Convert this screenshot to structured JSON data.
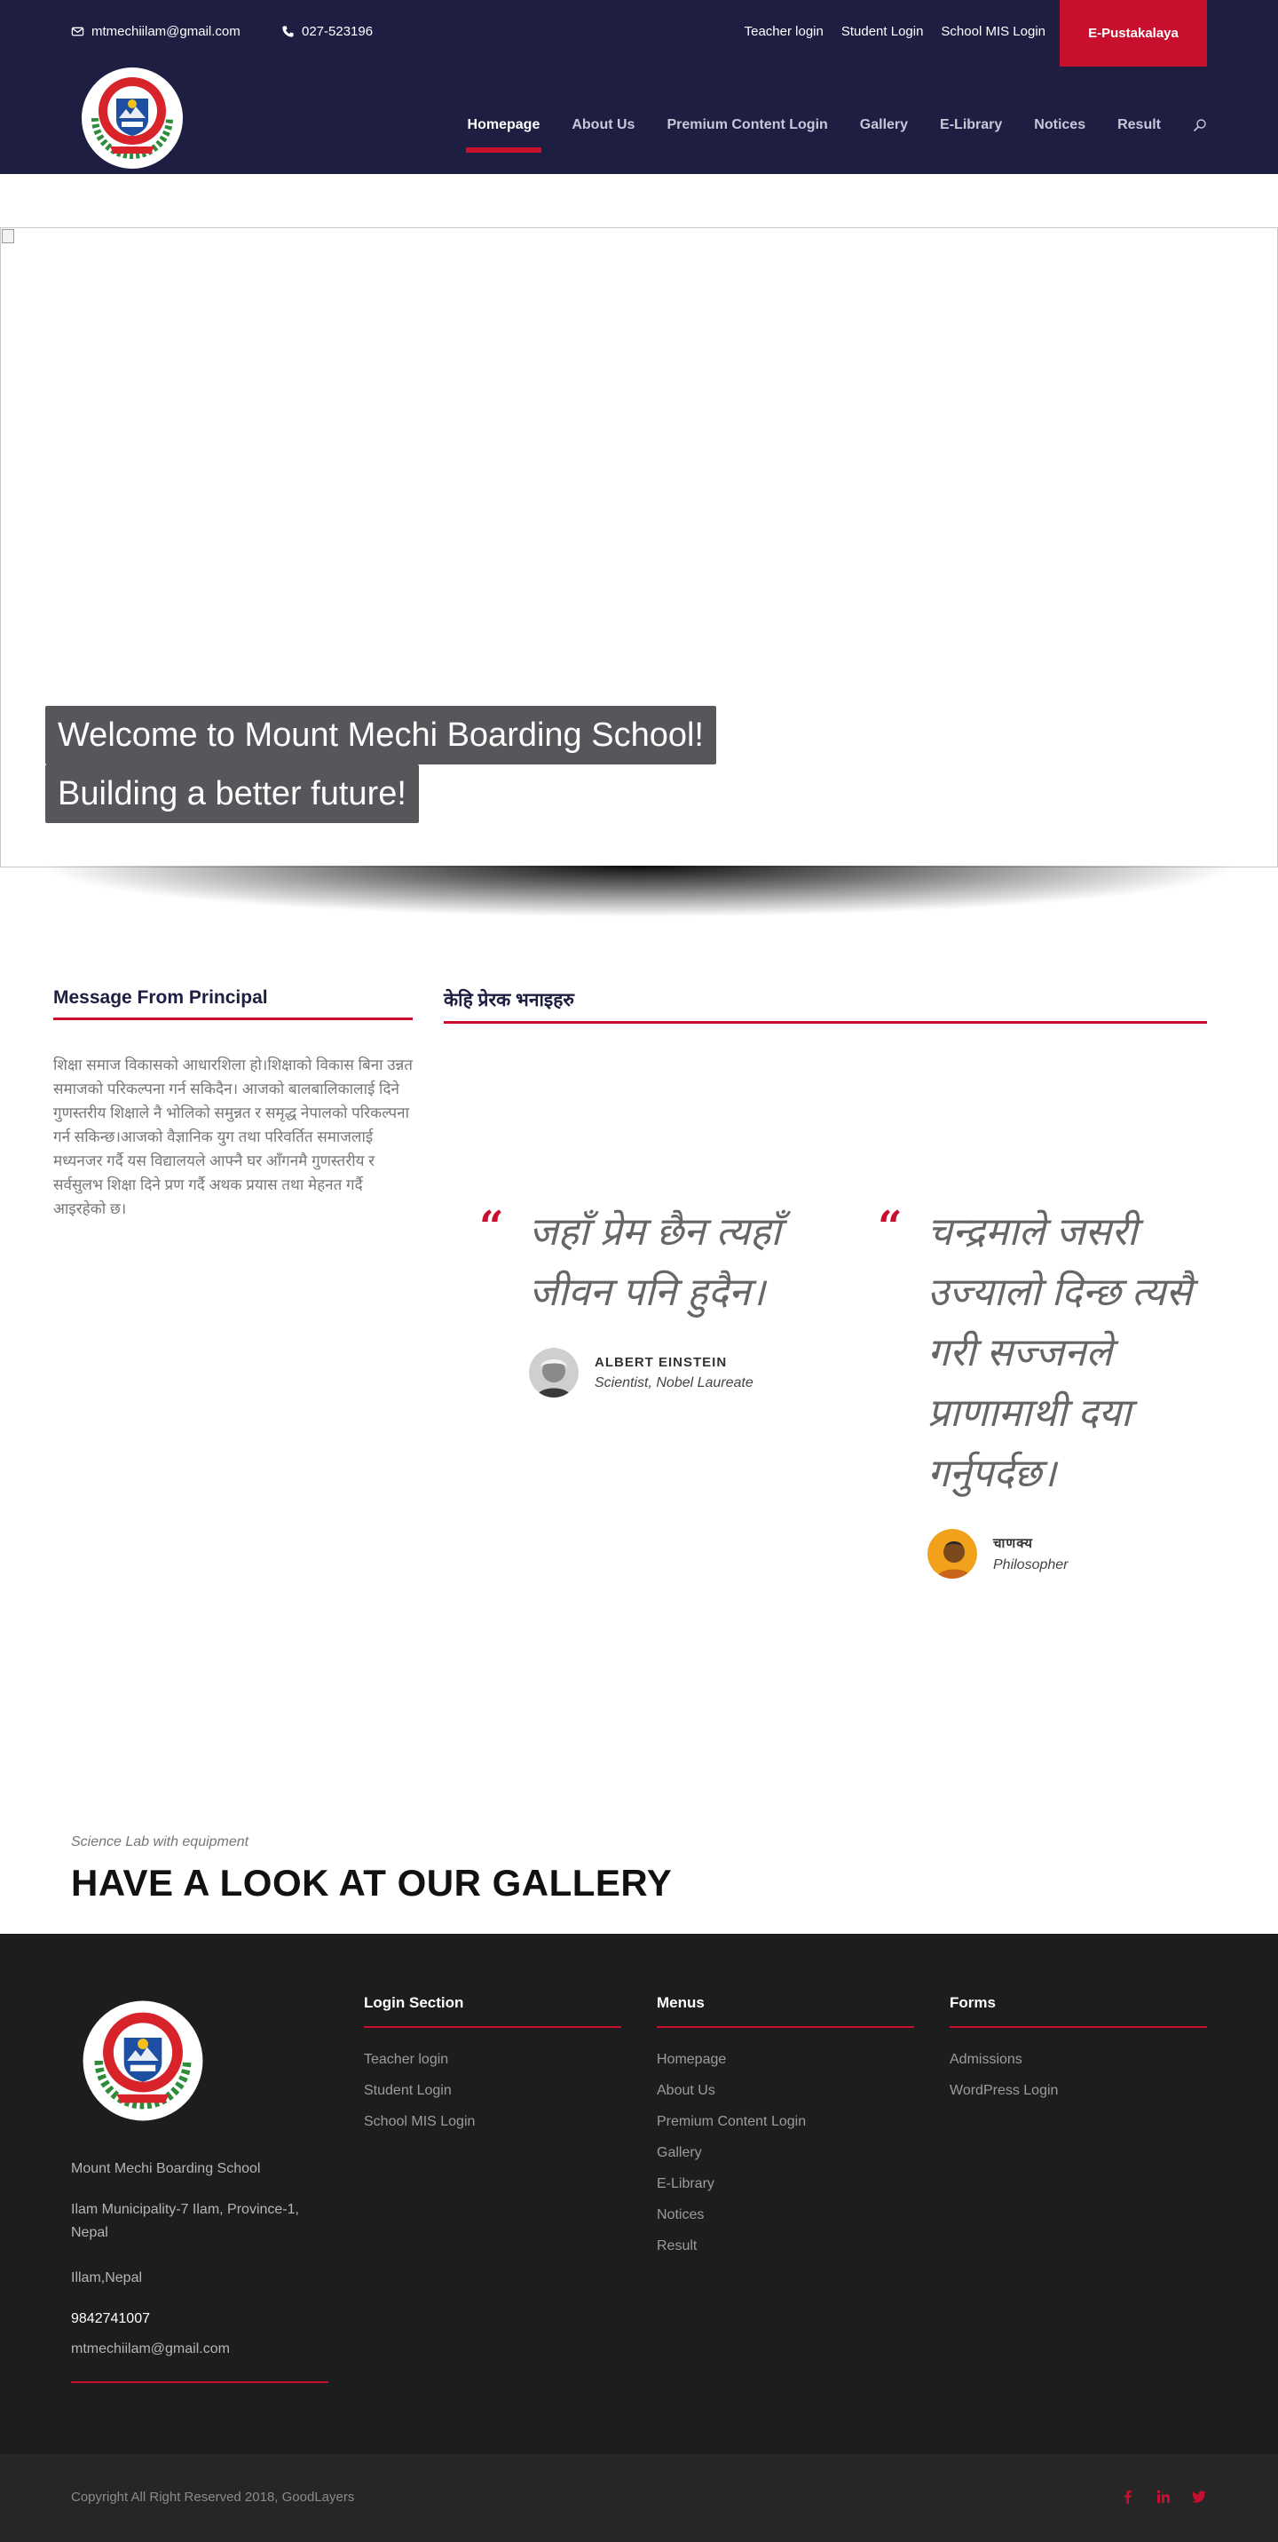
{
  "topbar": {
    "email": "mtmechiilam@gmail.com",
    "phone": "027-523196",
    "links": [
      "Teacher login",
      "Student Login",
      "School MIS Login"
    ],
    "cta": "E-Pustakalaya"
  },
  "nav": {
    "items": [
      "Homepage",
      "About Us",
      "Premium Content Login",
      "Gallery",
      "E-Library",
      "Notices",
      "Result"
    ],
    "active": "Homepage"
  },
  "hero": {
    "caption_1": "Welcome to Mount Mechi Boarding School!",
    "caption_2": "Building a better future!"
  },
  "principal": {
    "title": "Message From Principal",
    "text": "शिक्षा समाज विकासको आधारशिला हो।शिक्षाको विकास बिना उन्नत समाजको परिकल्पना गर्न सकिदैन। आजको बालबालिकालाई दिने गुणस्तरीय शिक्षाले नै भोलिको समुन्नत र समृद्ध नेपालको परिकल्पना गर्न सकिन्छ।आजको वैज्ञानिक युग तथा परिवर्तित समाजलाई मध्यनजर गर्दै यस विद्यालयले आफ्नै घर आँगनमै गुणस्तरीय र सर्वसुलभ शिक्षा दिने प्रण गर्दै अथक प्रयास तथा मेहनत गर्दै आइरहेको छ।"
  },
  "quotes": {
    "title": "केहि प्रेरक भनाइहरु",
    "items": [
      {
        "text": "जहाँ प्रेम छैन त्यहाँ जीवन पनि हुदैन।",
        "author": "ALBERT EINSTEIN",
        "role": "Scientist, Nobel Laureate"
      },
      {
        "text": "चन्द्रमाले जसरी उज्यालो दिन्छ त्यसै गरी सज्जनले प्राणामाथी दया गर्नुपर्दछ।",
        "author": "चाणक्य",
        "role": "Philosopher"
      }
    ]
  },
  "gallery": {
    "subtitle": "Science Lab with equipment",
    "title": "HAVE A LOOK AT OUR GALLERY"
  },
  "footer": {
    "school_name": "Mount Mechi Boarding School",
    "address": "Ilam Municipality-7 Ilam, Province-1, Nepal",
    "city": "Illam,Nepal",
    "phone": "9842741007",
    "email": "mtmechiilam@gmail.com",
    "login": {
      "title": "Login Section",
      "items": [
        "Teacher login",
        "Student Login",
        "School MIS Login"
      ]
    },
    "menus": {
      "title": "Menus",
      "items": [
        "Homepage",
        "About Us",
        "Premium Content Login",
        "Gallery",
        "E-Library",
        "Notices",
        "Result"
      ]
    },
    "forms": {
      "title": "Forms",
      "items": [
        "Admissions",
        "WordPress Login"
      ]
    },
    "copyright": "Copyright All Right Reserved 2018, GoodLayers"
  },
  "colors": {
    "navy": "#1e1d42",
    "accent": "#c8102e",
    "footer": "#1d1d1e",
    "bottombar": "#262627"
  },
  "icons": [
    "envelope-icon",
    "phone-icon",
    "search-icon",
    "facebook-icon",
    "linkedin-icon",
    "twitter-icon"
  ]
}
